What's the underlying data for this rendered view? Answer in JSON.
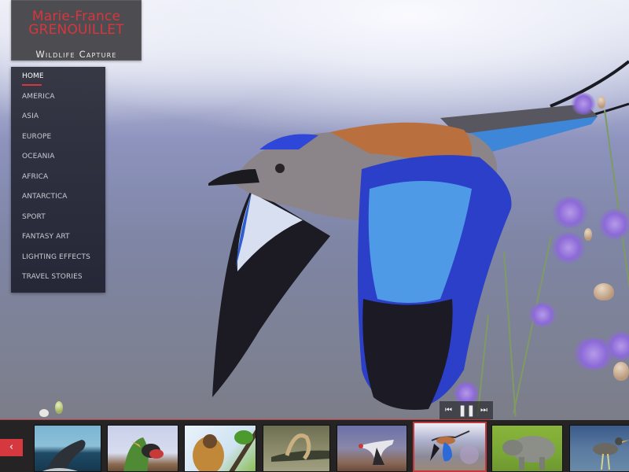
{
  "site": {
    "title_line1": "Marie-France",
    "title_line2": "GRENOUILLET",
    "tagline": "Wildlife Capture",
    "accent_color": "#d8353d"
  },
  "menu": {
    "items": [
      {
        "label": "HOME",
        "active": true
      },
      {
        "label": "AMERICA",
        "active": false
      },
      {
        "label": "ASIA",
        "active": false
      },
      {
        "label": "EUROPE",
        "active": false
      },
      {
        "label": "OCEANIA",
        "active": false
      },
      {
        "label": "AFRICA",
        "active": false
      },
      {
        "label": "ANTARCTICA",
        "active": false
      },
      {
        "label": "SPORT",
        "active": false
      },
      {
        "label": "FANTASY ART",
        "active": false
      },
      {
        "label": "LIGHTING EFFECTS",
        "active": false
      },
      {
        "label": "TRAVEL STORIES",
        "active": false
      }
    ]
  },
  "slideshow": {
    "current_image": "lilac-breasted roller in flight",
    "progress": 0.78,
    "controls": {
      "prev_icon": "skip-back-icon",
      "pause_icon": "pause-icon",
      "next_icon": "skip-forward-icon",
      "prev_glyph": "⏮",
      "pause_glyph": "❚❚",
      "next_glyph": "⏭"
    },
    "strip_prev_glyph": "‹",
    "thumbnails": [
      {
        "subject": "whale breaching",
        "selected": false
      },
      {
        "subject": "aracari on branch",
        "selected": false
      },
      {
        "subject": "golden langur monkey",
        "selected": false
      },
      {
        "subject": "crocodile with snake",
        "selected": false
      },
      {
        "subject": "crane in flight",
        "selected": false
      },
      {
        "subject": "roller in flight",
        "selected": true
      },
      {
        "subject": "rhinoceros calf",
        "selected": false
      },
      {
        "subject": "heron in water",
        "selected": false
      }
    ]
  }
}
